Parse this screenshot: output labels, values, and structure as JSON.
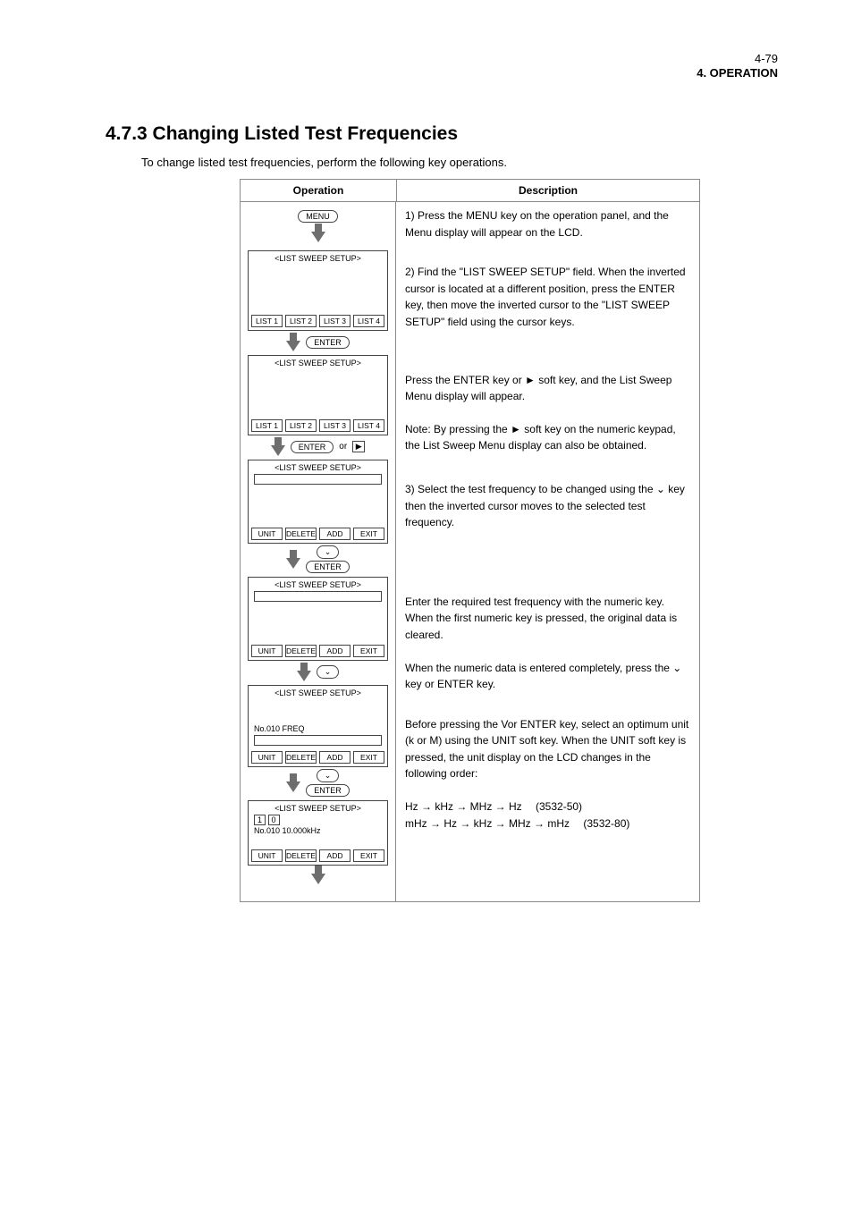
{
  "page_number": "4-79",
  "chapter": "4.  OPERATION",
  "section_title": "4.7.3 Changing Listed Test Frequencies",
  "section_desc": "To change listed test frequencies, perform the following key operations.",
  "table_header": {
    "left": "Operation",
    "right": "Description"
  },
  "pill_menu": "MENU",
  "pill_enter": "ENTER",
  "pill_down": "⌄",
  "right": {
    "p1": "1) Press the MENU key on the operation panel, and the Menu display will appear on the LCD.",
    "p2": "2) Find the \"LIST SWEEP SETUP\" field. When the inverted cursor is located at a different position, press the ENTER key, then move the inverted cursor to the \"LIST SWEEP SETUP\" field using the cursor keys.",
    "p3": "Press the ENTER key or ► soft key, and the List Sweep Menu display will appear.",
    "note3": "Note: By pressing the ► soft key on the numeric keypad, the List Sweep Menu display can also be obtained.",
    "p4": "3) Select the test frequency to be changed using the ⌄ key then the inverted cursor moves to the selected test frequency.",
    "p5": "Enter the required test frequency with the numeric key. When the first numeric key is pressed, the original data is cleared.",
    "p5b": "When the numeric data is entered completely, press the ⌄ key or ENTER key.",
    "p_unit": "Before pressing the Vor ENTER key, select an optimum unit (k or M) using the UNIT soft key. When the UNIT soft key is pressed, the unit display on the LCD changes in the following order:",
    "unit_seq_a": "Hz → kHz → MHz → Hz",
    "unit_seq_label": "(3532-50)",
    "unit_seq_b": "mHz → Hz → kHz → MHz → mHz",
    "unit_seq_label2": "(3532-80)"
  },
  "cards": {
    "c1": {
      "title": "<LIST SWEEP SETUP>",
      "quad": [
        "LIST 1",
        "LIST 2",
        "LIST 3",
        "LIST 4"
      ]
    },
    "c2": {
      "title": "<LIST SWEEP SETUP>",
      "quad": [
        "LIST 1",
        "LIST 2",
        "LIST 3",
        "LIST 4"
      ]
    },
    "c3": {
      "title": "<LIST SWEEP SETUP>",
      "quad": [
        "UNIT",
        "DELETE",
        "ADD",
        "EXIT"
      ]
    },
    "c4": {
      "title": "<LIST SWEEP SETUP>",
      "quad": [
        "UNIT",
        "DELETE",
        "ADD",
        "EXIT"
      ]
    },
    "c5": {
      "title": "<LIST SWEEP SETUP>",
      "line": "No.010   FREQ",
      "quad": [
        "UNIT",
        "DELETE",
        "ADD",
        "EXIT"
      ]
    },
    "c6": {
      "title": "<LIST SWEEP SETUP>",
      "line": "No.010   10.000kHz",
      "key_example": "1 0",
      "quad": [
        "UNIT",
        "DELETE",
        "ADD",
        "EXIT"
      ]
    }
  }
}
